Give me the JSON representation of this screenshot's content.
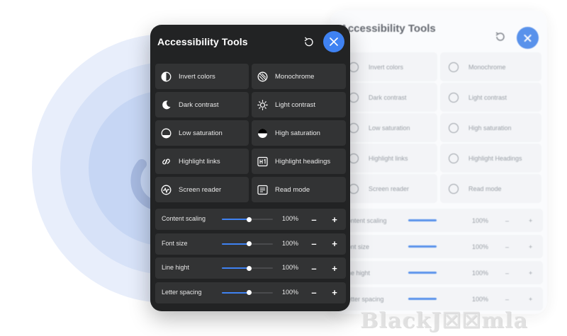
{
  "panel": {
    "title": "Accessibility Tools",
    "reset_icon": "reset-icon",
    "close_icon": "close-icon"
  },
  "tools": [
    {
      "label": "Invert colors",
      "icon": "invert-colors-icon"
    },
    {
      "label": "Monochrome",
      "icon": "monochrome-icon"
    },
    {
      "label": "Dark contrast",
      "icon": "moon-icon"
    },
    {
      "label": "Light contrast",
      "icon": "sun-icon"
    },
    {
      "label": "Low saturation",
      "icon": "low-saturation-icon"
    },
    {
      "label": "High saturation",
      "icon": "high-saturation-icon"
    },
    {
      "label": "Highlight links",
      "icon": "link-icon"
    },
    {
      "label": "Highlight headings",
      "icon": "heading-icon"
    },
    {
      "label": "Screen reader",
      "icon": "screen-reader-icon"
    },
    {
      "label": "Read mode",
      "icon": "read-mode-icon"
    }
  ],
  "sliders": [
    {
      "label": "Content scaling",
      "value": "100%",
      "fill": 0.53,
      "minus": "–",
      "plus": "+"
    },
    {
      "label": "Font size",
      "value": "100%",
      "fill": 0.53,
      "minus": "–",
      "plus": "+"
    },
    {
      "label": "Line hight",
      "value": "100%",
      "fill": 0.53,
      "minus": "–",
      "plus": "+"
    },
    {
      "label": "Letter spacing",
      "value": "100%",
      "fill": 0.53,
      "minus": "–",
      "plus": "+"
    }
  ],
  "ghost": {
    "title": "Accessibility Tools",
    "tools": [
      "Invert colors",
      "Monochrome",
      "Dark contrast",
      "Light contrast",
      "Low saturation",
      "High saturation",
      "Highlight links",
      "Highlight Headings",
      "Screen reader",
      "Read mode"
    ],
    "sliders": [
      {
        "label": "ontent scaling",
        "value": "100%",
        "minus": "–",
        "plus": "+"
      },
      {
        "label": "ont size",
        "value": "100%",
        "minus": "–",
        "plus": "+"
      },
      {
        "label": "ne hight",
        "value": "100%",
        "minus": "–",
        "plus": "+"
      },
      {
        "label": "etter spacing",
        "value": "100%",
        "minus": "–",
        "plus": "+"
      }
    ]
  },
  "watermark": "BlackJ☒☒mla",
  "colors": {
    "accent": "#3f82f2",
    "panel_bg": "#222324",
    "tile_bg": "#323334",
    "text": "#e8e8e8"
  }
}
